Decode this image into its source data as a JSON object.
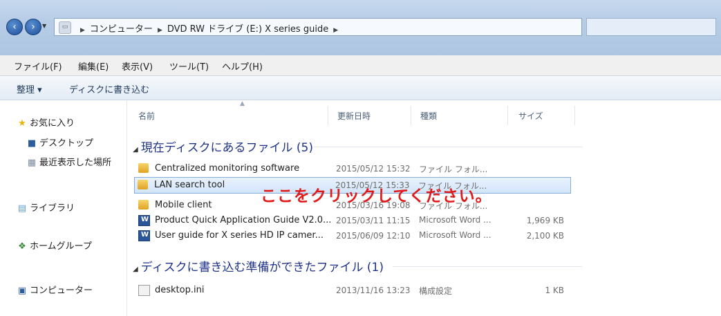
{
  "address": {
    "crumbs": [
      "コンピューター",
      "DVD RW ドライブ (E:) X series guide"
    ]
  },
  "menu": [
    "ファイル(F)",
    "編集(E)",
    "表示(V)",
    "ツール(T)",
    "ヘルプ(H)"
  ],
  "toolbar": {
    "organize": "整理 ▾",
    "burn": "ディスクに書き込む"
  },
  "nav": {
    "favorites": "お気に入り",
    "desktop": "デスクトップ",
    "recent": "最近表示した場所",
    "libraries": "ライブラリ",
    "homegroup": "ホームグループ",
    "computer": "コンピューター"
  },
  "columns": {
    "name": "名前",
    "date": "更新日時",
    "type": "種類",
    "size": "サイズ"
  },
  "groups": [
    {
      "title": "現在ディスクにあるファイル (5)",
      "rows": [
        {
          "name": "Centralized monitoring software",
          "date": "2015/05/12 15:32",
          "type": "ファイル フォル...",
          "size": ""
        },
        {
          "name": "LAN search tool",
          "date": "2015/05/12 15:33",
          "type": "ファイル フォル...",
          "size": ""
        },
        {
          "name": "Mobile client",
          "date": "2015/03/16 19:08",
          "type": "ファイル フォル...",
          "size": ""
        },
        {
          "name": "Product Quick Application Guide V2.0...",
          "date": "2015/03/11 11:15",
          "type": "Microsoft Word ...",
          "size": "1,969 KB"
        },
        {
          "name": "User guide for X series HD IP camer...",
          "date": "2015/06/09 12:10",
          "type": "Microsoft Word ...",
          "size": "2,100 KB"
        }
      ]
    },
    {
      "title": "ディスクに書き込む準備ができたファイル (1)",
      "rows": [
        {
          "name": "desktop.ini",
          "date": "2013/11/16 13:23",
          "type": "構成設定",
          "size": "1 KB"
        }
      ]
    }
  ],
  "annotation": "ここをクリックしてください。"
}
